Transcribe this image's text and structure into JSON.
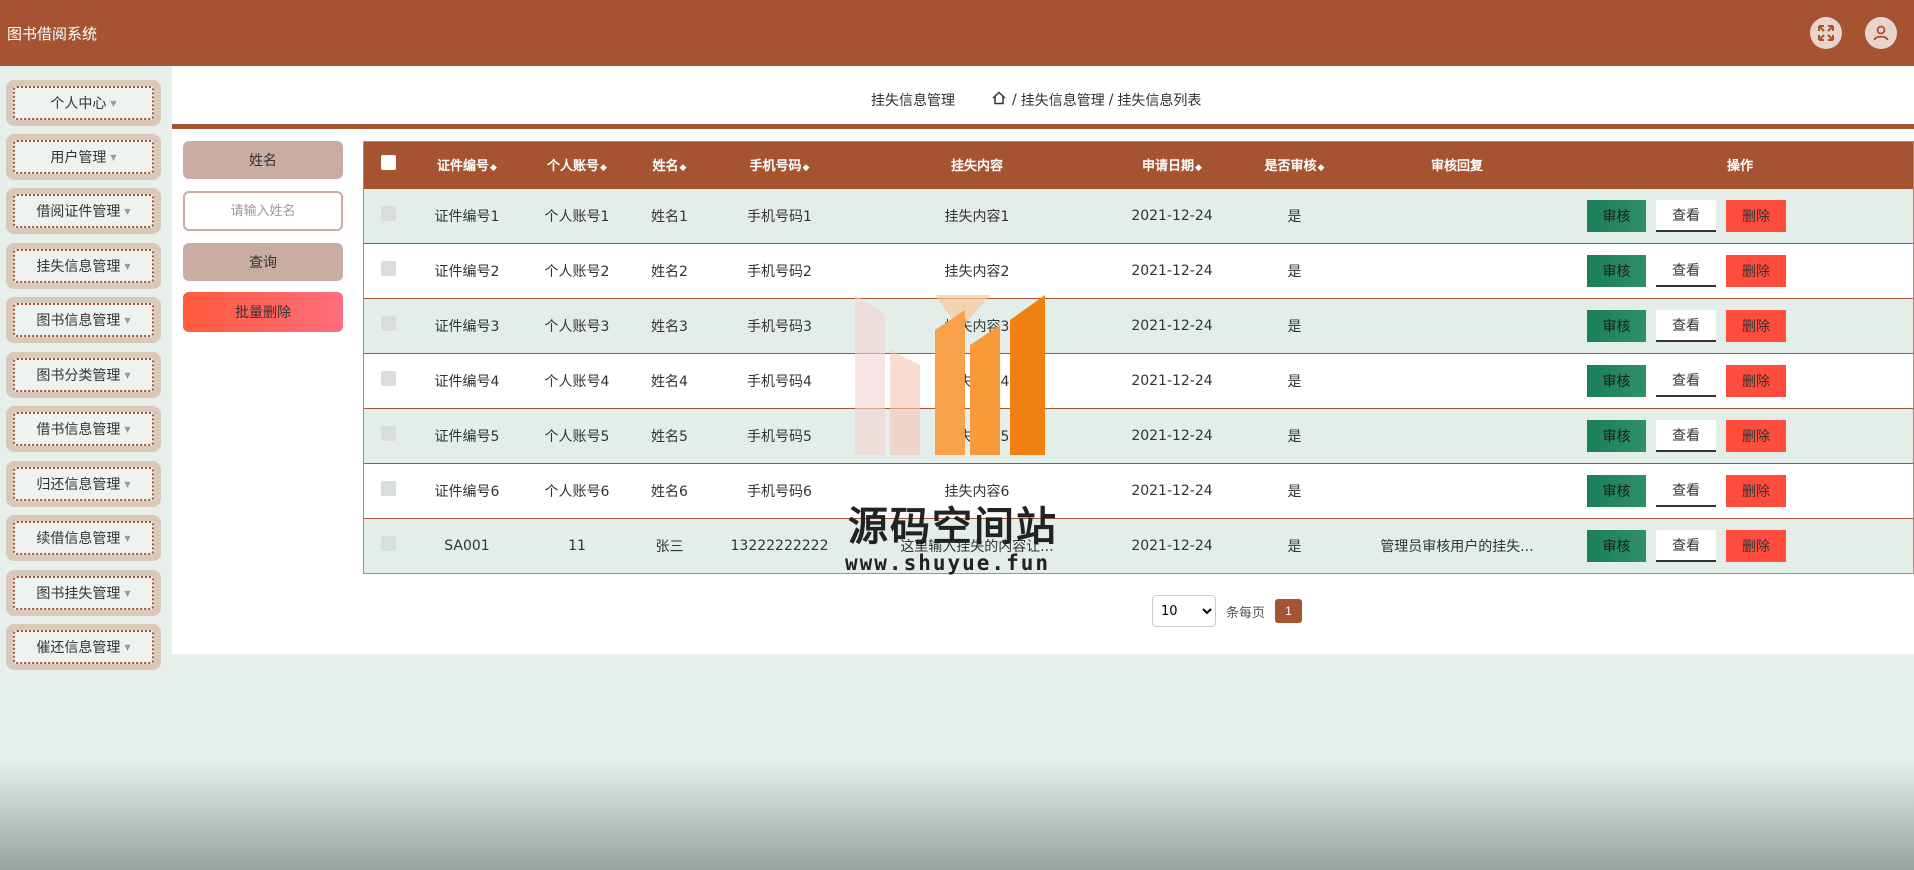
{
  "header": {
    "app_title": "图书借阅系统",
    "fullscreen_icon": "fullscreen-icon",
    "user_icon": "user-icon"
  },
  "sidebar": {
    "items": [
      {
        "label": "个人中心"
      },
      {
        "label": "用户管理"
      },
      {
        "label": "借阅证件管理"
      },
      {
        "label": "挂失信息管理"
      },
      {
        "label": "图书信息管理"
      },
      {
        "label": "图书分类管理"
      },
      {
        "label": "借书信息管理"
      },
      {
        "label": "归还信息管理"
      },
      {
        "label": "续借信息管理"
      },
      {
        "label": "图书挂失管理"
      },
      {
        "label": "催还信息管理"
      }
    ]
  },
  "breadcrumb": {
    "title": "挂失信息管理",
    "path": [
      "挂失信息管理",
      "挂失信息列表"
    ],
    "separator": "/"
  },
  "search": {
    "label": "姓名",
    "placeholder": "请输入姓名",
    "query_button": "查询",
    "batch_delete_button": "批量删除"
  },
  "table": {
    "columns": [
      "证件编号",
      "个人账号",
      "姓名",
      "手机号码",
      "挂失内容",
      "申请日期",
      "是否审核",
      "审核回复",
      "操作"
    ],
    "rows": [
      {
        "id": "证件编号1",
        "account": "个人账号1",
        "name": "姓名1",
        "phone": "手机号码1",
        "content": "挂失内容1",
        "date": "2021-12-24",
        "audited": "是",
        "reply": ""
      },
      {
        "id": "证件编号2",
        "account": "个人账号2",
        "name": "姓名2",
        "phone": "手机号码2",
        "content": "挂失内容2",
        "date": "2021-12-24",
        "audited": "是",
        "reply": ""
      },
      {
        "id": "证件编号3",
        "account": "个人账号3",
        "name": "姓名3",
        "phone": "手机号码3",
        "content": "挂失内容3",
        "date": "2021-12-24",
        "audited": "是",
        "reply": ""
      },
      {
        "id": "证件编号4",
        "account": "个人账号4",
        "name": "姓名4",
        "phone": "手机号码4",
        "content": "挂失内容4",
        "date": "2021-12-24",
        "audited": "是",
        "reply": ""
      },
      {
        "id": "证件编号5",
        "account": "个人账号5",
        "name": "姓名5",
        "phone": "手机号码5",
        "content": "挂失内容5",
        "date": "2021-12-24",
        "audited": "是",
        "reply": ""
      },
      {
        "id": "证件编号6",
        "account": "个人账号6",
        "name": "姓名6",
        "phone": "手机号码6",
        "content": "挂失内容6",
        "date": "2021-12-24",
        "audited": "是",
        "reply": ""
      },
      {
        "id": "SA001",
        "account": "11",
        "name": "张三",
        "phone": "13222222222",
        "content": "这里输入挂失的内容让...",
        "date": "2021-12-24",
        "audited": "是",
        "reply": "管理员审核用户的挂失..."
      }
    ],
    "actions": {
      "audit": "审核",
      "view": "查看",
      "delete": "删除"
    }
  },
  "pagination": {
    "page_size": "10",
    "per_page_label": "条每页",
    "current_page": "1"
  },
  "watermark": {
    "title": "源码空间站",
    "url": "www.shuyue.fun"
  },
  "colors": {
    "brand": "#a65332",
    "audit_button": "#1a7f5a",
    "delete_button": "#ff4d3d"
  }
}
